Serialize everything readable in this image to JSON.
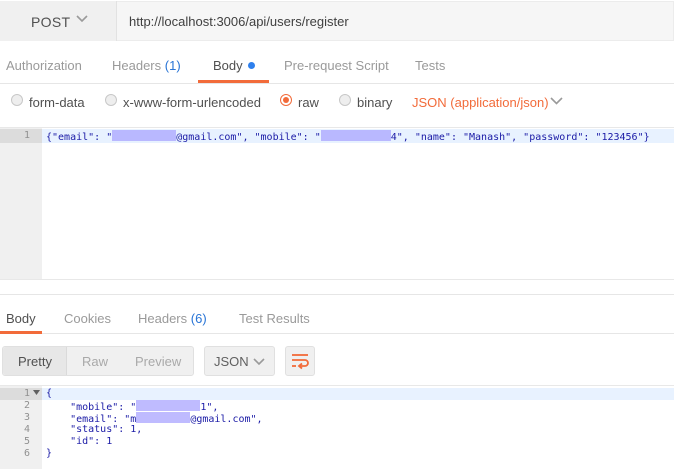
{
  "request": {
    "method": "POST",
    "url": "http://localhost:3006/api/users/register"
  },
  "request_tabs": {
    "authorization": "Authorization",
    "headers": "Headers",
    "headers_count": "(1)",
    "body": "Body",
    "pre_request": "Pre-request Script",
    "tests": "Tests"
  },
  "body_types": {
    "form_data": "form-data",
    "urlencoded": "x-www-form-urlencoded",
    "raw": "raw",
    "binary": "binary",
    "selected": "raw",
    "content_type": "JSON (application/json)"
  },
  "request_body": {
    "line_number": "1",
    "seg1": "{\"email\": \"",
    "seg2": "@gmail.com\", \"mobile\": \"",
    "seg3": "4\", \"name\": \"Manash\", \"password\": \"123456\"}"
  },
  "response_tabs": {
    "body": "Body",
    "cookies": "Cookies",
    "headers": "Headers",
    "headers_count": "(6)",
    "test_results": "Test Results"
  },
  "view_modes": {
    "pretty": "Pretty",
    "raw": "Raw",
    "preview": "Preview",
    "format": "JSON"
  },
  "response_body": {
    "line_numbers": [
      "1",
      "2",
      "3",
      "4",
      "5",
      "6"
    ],
    "l1": "{",
    "l2a": "    \"mobile\": \"",
    "l2b": "1\",",
    "l3a": "    \"email\": \"m",
    "l3b": "@gmail.com\",",
    "l4": "    \"status\": 1,",
    "l5": "    \"id\": 1",
    "l6": "}"
  },
  "colors": {
    "accent": "#f26b3a",
    "link_blue": "#2874d6",
    "code_blue": "#1a1aa6",
    "redaction": "#a9a4ff"
  }
}
